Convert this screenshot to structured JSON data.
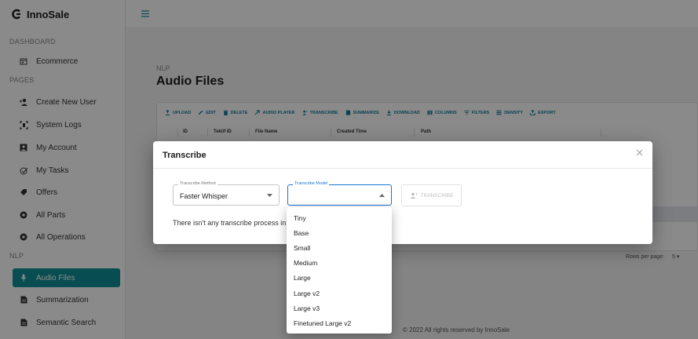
{
  "app": {
    "name": "InnoSale"
  },
  "sidebar": {
    "sections": [
      "DASHBOARD",
      "PAGES",
      "NLP"
    ],
    "items": [
      {
        "label": "Ecommerce",
        "icon": "calendar-icon"
      },
      {
        "label": "Create New User",
        "icon": "add-user-icon"
      },
      {
        "label": "System Logs",
        "icon": "logs-icon"
      },
      {
        "label": "My Account",
        "icon": "account-icon"
      },
      {
        "label": "My Tasks",
        "icon": "tasks-icon"
      },
      {
        "label": "Offers",
        "icon": "tag-icon"
      },
      {
        "label": "All Parts",
        "icon": "parts-icon"
      },
      {
        "label": "All Operations",
        "icon": "operations-icon"
      },
      {
        "label": "Audio Files",
        "icon": "mic-icon",
        "active": true
      },
      {
        "label": "Summarization",
        "icon": "document-icon"
      },
      {
        "label": "Semantic Search",
        "icon": "search-doc-icon"
      }
    ]
  },
  "main": {
    "breadcrumb": "NLP",
    "title": "Audio Files",
    "toolbar": {
      "upload": "UPLOAD",
      "edit": "EDIT",
      "delete": "DELETE",
      "audio_player": "AUDIO PLAYER",
      "transcribe": "TRANSCRIBE",
      "summarize": "SUMMARIZE",
      "download": "DOWNLOAD",
      "columns": "COLUMNS",
      "filters": "FILTERS",
      "density": "DENSITY",
      "export": "EXPORT"
    },
    "columns": [
      "ID",
      "Teklif ID",
      "File Name",
      "Created Time",
      "Path"
    ],
    "rows_per_page_label": "Rows per page:",
    "rows_per_page_value": "5"
  },
  "footer": "© 2022 All rights reserved by InnoSale",
  "modal": {
    "title": "Transcribe",
    "method_label": "Transcribe Method",
    "method_value": "Faster Whisper",
    "model_label": "Transcribe Model",
    "model_value": "",
    "button_label": "TRANSCRIBE",
    "info_text": "There isn't any transcribe process in"
  },
  "dropdown": {
    "options": [
      "Tiny",
      "Base",
      "Small",
      "Medium",
      "Large",
      "Large v2",
      "Large v3",
      "Finetuned Large v2"
    ]
  },
  "colors": {
    "accent": "#0f8f96",
    "toolbar": "#0f7a9c",
    "focus": "#1976d2"
  }
}
